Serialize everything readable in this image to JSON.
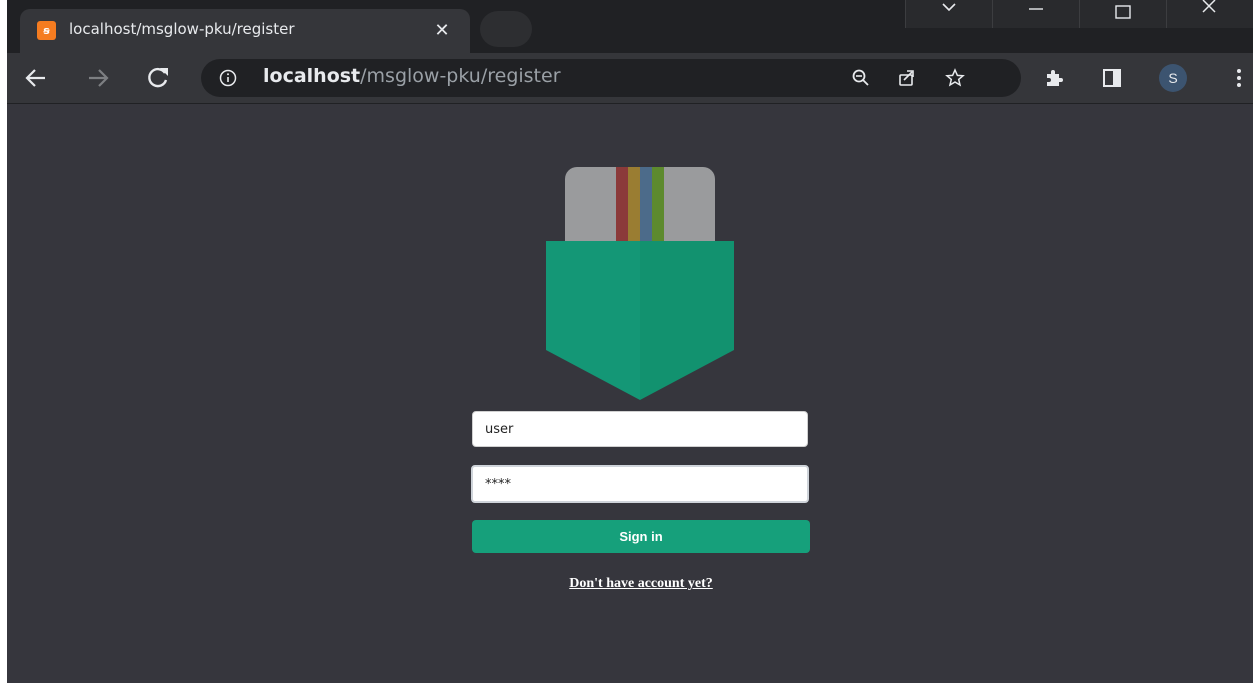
{
  "browser": {
    "tab_title": "localhost/msglow-pku/register",
    "tab_close": "✕",
    "favicon_text": "ꞩ",
    "url_host": "localhost",
    "url_path": "/msglow-pku/register",
    "profile_initial": "S"
  },
  "login": {
    "username_value": "user",
    "password_value": "****",
    "signin_label": "Sign in",
    "register_link": "Don't have account yet?"
  },
  "colors": {
    "accent": "#16a07b",
    "page_bg": "#36363d"
  }
}
